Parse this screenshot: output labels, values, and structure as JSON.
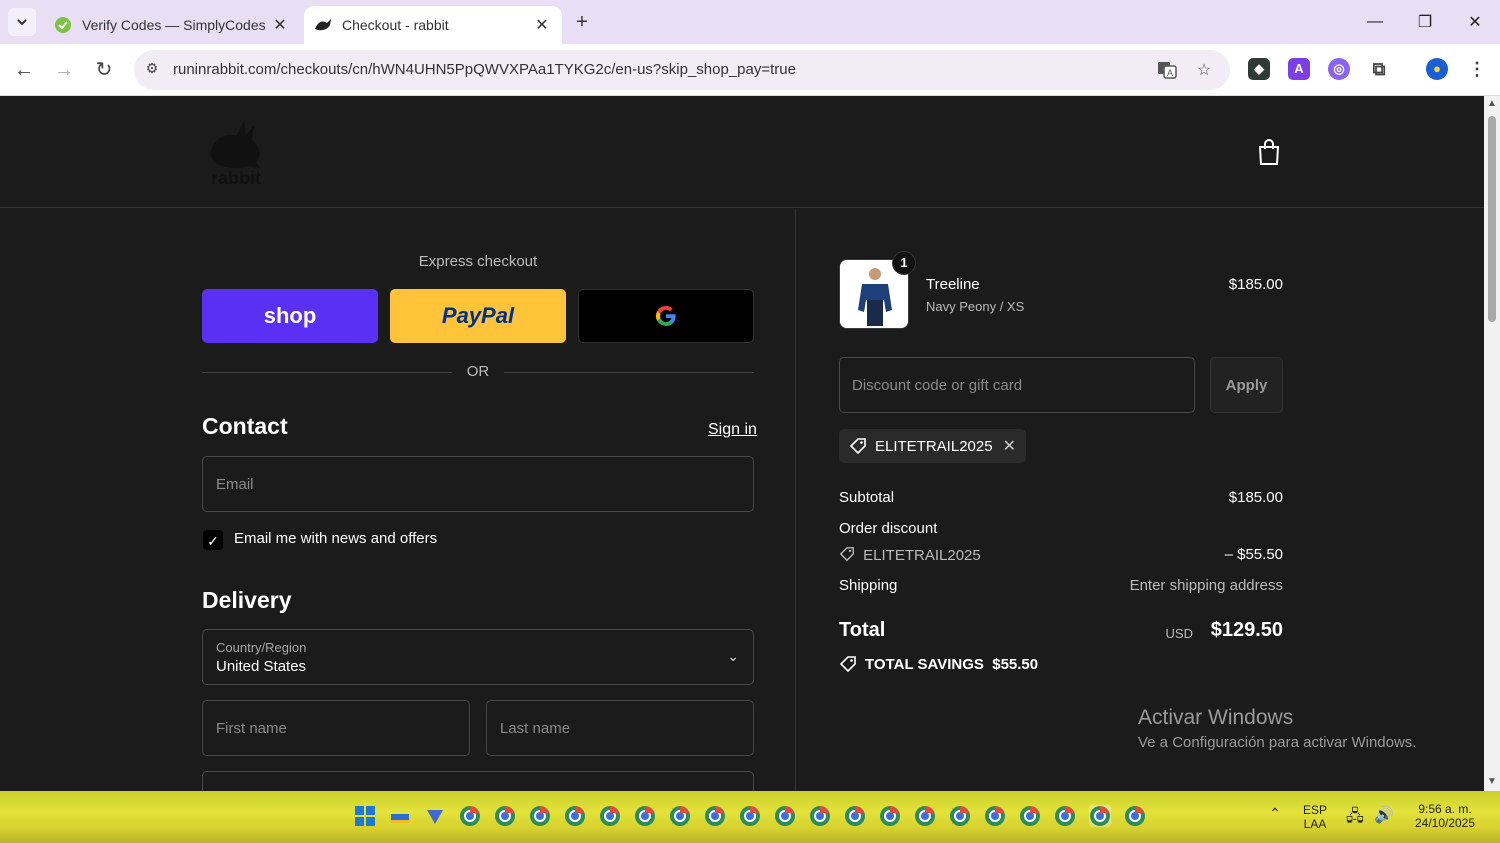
{
  "browser": {
    "tabs": [
      {
        "title": "Verify Codes — SimplyCodes",
        "active": false
      },
      {
        "title": "Checkout - rabbit",
        "active": true
      }
    ],
    "url": "runinrabbit.com/checkouts/cn/hWN4UHN5PpQWVXPAa1TYKG2c/en-us?skip_shop_pay=true"
  },
  "checkout": {
    "express_label": "Express checkout",
    "shop_label": "shop",
    "paypal_label": "PayPal",
    "or_label": "OR",
    "contact_title": "Contact",
    "signin_label": "Sign in",
    "email_placeholder": "Email",
    "news_label": "Email me with news and offers",
    "news_checked": true,
    "delivery_title": "Delivery",
    "country_label": "Country/Region",
    "country_value": "United States",
    "first_name_placeholder": "First name",
    "last_name_placeholder": "Last name"
  },
  "summary": {
    "product": {
      "name": "Treeline",
      "variant": "Navy Peony / XS",
      "price": "$185.00",
      "qty": "1"
    },
    "discount_placeholder": "Discount code or gift card",
    "apply_label": "Apply",
    "applied_code": "ELITETRAIL2025",
    "subtotal_label": "Subtotal",
    "subtotal_value": "$185.00",
    "order_discount_label": "Order discount",
    "order_discount_code": "ELITETRAIL2025",
    "order_discount_value": "– $55.50",
    "shipping_label": "Shipping",
    "shipping_value": "Enter shipping address",
    "total_label": "Total",
    "total_currency": "USD",
    "total_value": "$129.50",
    "savings_label": "TOTAL SAVINGS  $55.50"
  },
  "watermark": {
    "line1": "Activar Windows",
    "line2": "Ve a Configuración para activar Windows."
  },
  "taskbar": {
    "lang1": "ESP",
    "lang2": "LAA",
    "time": "9:56 a. m.",
    "date": "24/10/2025"
  },
  "colors": {
    "shop": "#5a31f4",
    "paypal": "#ffc439",
    "page_bg": "#1b1b1b",
    "tabstrip": "#e9dff4"
  }
}
